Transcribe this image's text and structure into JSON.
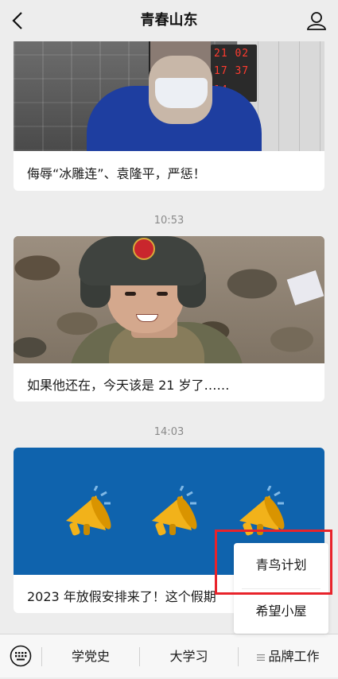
{
  "header": {
    "title": "青春山东",
    "back_icon": "chevron-left-icon",
    "profile_icon": "user-icon"
  },
  "feed": [
    {
      "time": "",
      "caption": "侮辱“冰雕连”、袁隆平，严惩！"
    },
    {
      "time": "10:53",
      "caption": "如果他还在，今天该是 21 岁了……"
    },
    {
      "time": "14:03",
      "caption": "2023 年放假安排来了！这个假期"
    }
  ],
  "image1_clock": {
    "line1": "21 02",
    "line2": "17 37",
    "line3": "14"
  },
  "popup_menu": {
    "items": [
      "青鸟计划",
      "希望小屋"
    ]
  },
  "tabbar": {
    "keyboard_icon": "keyboard-icon",
    "tabs": [
      "学党史",
      "大学习",
      "品牌工作"
    ],
    "menu_icon": "list-icon"
  },
  "colors": {
    "highlight": "#e8232b",
    "banner_blue": "#0f63ad",
    "megaphone": "#f2b21a"
  }
}
